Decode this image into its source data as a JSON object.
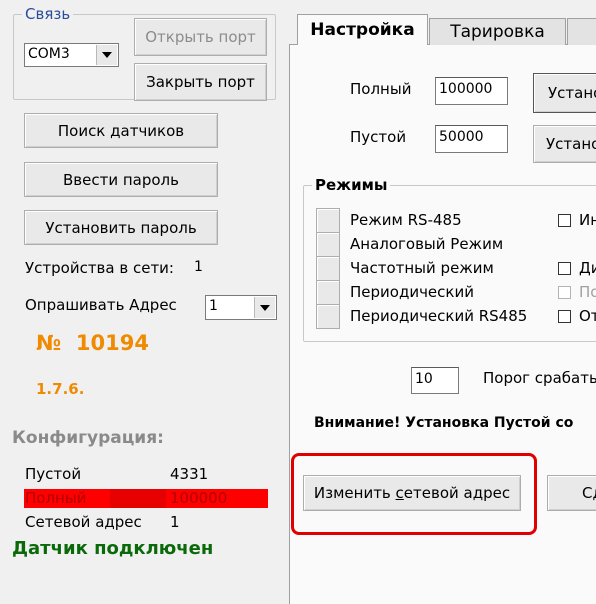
{
  "connection": {
    "group_label": "Связь",
    "port_value": "COM3",
    "open_port_label": "Открыть порт",
    "close_port_label": "Закрыть порт"
  },
  "buttons": {
    "search_sensors": "Поиск датчиков",
    "enter_password": "Ввести пароль",
    "set_password": "Установить пароль"
  },
  "network": {
    "devices_label": "Устройства в сети:",
    "devices_count": "1",
    "poll_address_label": "Опрашивать Адрес",
    "poll_address_value": "1"
  },
  "device": {
    "number": "№  10194",
    "version": "1.7.6.",
    "number_color": "#f08a00"
  },
  "config": {
    "title": "Конфигурация:",
    "rows": [
      {
        "label": "Пустой",
        "value": "4331"
      },
      {
        "label": "Полный",
        "value": "100000"
      },
      {
        "label": "Сетевой адрес",
        "value": "1"
      }
    ],
    "highlight_color": "#ff0000",
    "status": "Датчик подключен",
    "status_color": "#0a6a0a"
  },
  "tabs": [
    {
      "label": "Настройка",
      "active": true
    },
    {
      "label": "Тарировка",
      "active": false
    }
  ],
  "settings": {
    "full_label": "Полный",
    "full_value": "100000",
    "full_button": "Устано",
    "empty_label": "Пустой",
    "empty_value": "50000",
    "empty_button": "Устано"
  },
  "modes": {
    "group_label": "Режимы",
    "items": [
      "Режим RS-485",
      "Аналоговый Режим",
      "Частотный режим",
      "Периодический",
      "Периодический RS485"
    ],
    "right_checks": [
      "Ин",
      "Ди",
      "По",
      "От"
    ]
  },
  "threshold": {
    "value": "10",
    "label": "Порог срабаты"
  },
  "warning": "Внимание! Установка Пустой со",
  "change_address": {
    "label": "Изменить сетевой адрес",
    "underline_char_index": 9,
    "next_button": "Сд",
    "highlight_color": "#e00000"
  }
}
